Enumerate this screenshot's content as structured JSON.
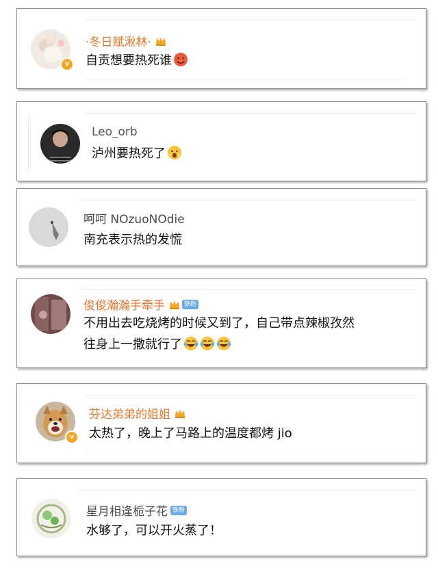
{
  "colors": {
    "vip_name": "#e8772c",
    "plain_name": "#4a4a4a",
    "badge": "#f5a623",
    "fan_badge": "#6aa8e8",
    "text": "#111111"
  },
  "comments": [
    {
      "user": "·冬日赋湫林·",
      "vip": true,
      "verified": true,
      "crown": true,
      "fan_badge": "",
      "text": "自贡想要热死谁",
      "emojis": [
        "hot-face-emoji"
      ]
    },
    {
      "user": "Leo_orb",
      "vip": false,
      "verified": false,
      "crown": false,
      "fan_badge": "",
      "text": "泸州要热死了",
      "emojis": [
        "shocked-face-emoji"
      ]
    },
    {
      "user": "呵呵 NOzuoNOdie",
      "vip": false,
      "verified": false,
      "crown": false,
      "fan_badge": "",
      "text": "南充表示热的发慌",
      "emojis": []
    },
    {
      "user": "俊俊瀚瀚手牵手",
      "vip": true,
      "verified": false,
      "crown": true,
      "fan_badge": "铁粉",
      "text": "不用出去吃烧烤的时候又到了，自己带点辣椒孜然",
      "text2": "往身上一撒就行了",
      "emojis": [
        "tears-of-joy-emoji",
        "tears-of-joy-emoji",
        "tears-of-joy-emoji"
      ]
    },
    {
      "user": "芬达弟弟的姐姐",
      "vip": true,
      "verified": true,
      "crown": true,
      "fan_badge": "",
      "text": "太热了，晚上了马路上的温度都烤 jio",
      "emojis": []
    },
    {
      "user": "星月相逢栀子花",
      "vip": false,
      "verified": false,
      "crown": false,
      "fan_badge": "铁粉",
      "text": "水够了，可以开火蒸了！",
      "emojis": []
    }
  ]
}
